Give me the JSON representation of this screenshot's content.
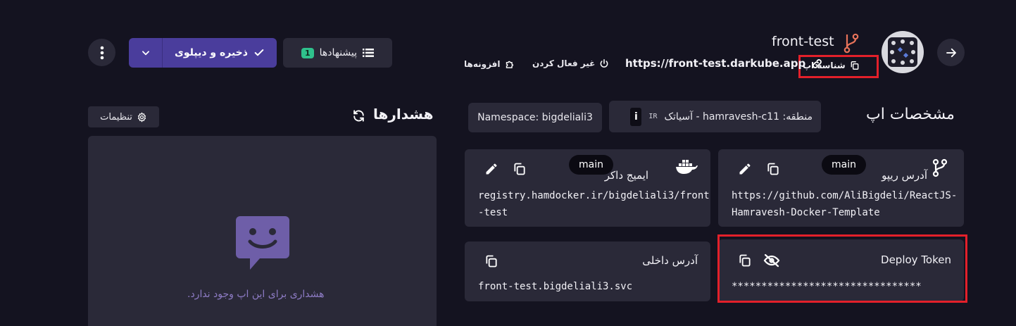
{
  "header": {
    "app_name": "front-test",
    "app_id_label": "شناسه اپ",
    "app_url": "https://front-test.darkube.app",
    "disable_label": "غیر فعال کردن",
    "addons_label": "افزونه‌ها",
    "save_deploy_label": "ذخیره و دیپلوی",
    "suggestions_label": "پیشنهادها",
    "suggestions_count": "1"
  },
  "specs": {
    "title": "مشخصات اپ",
    "region_label": "منطقه: hamravesh-c11 - آسیاتک",
    "region_flag": "IR",
    "namespace_label": "Namespace: bigdeliali3",
    "repo": {
      "title": "آدرس ریپو",
      "branch": "main",
      "value_line1": "https://github.com/AliBigdeli/ReactJS-",
      "value_line2": "Hamravesh-Docker-Template"
    },
    "image": {
      "title": "ایمیج داکر",
      "branch": "main",
      "value_line1": "registry.hamdocker.ir/bigdeliali3/front",
      "value_line2": "-test"
    },
    "token": {
      "title": "Deploy Token",
      "value": "********************************"
    },
    "internal": {
      "title": "آدرس داخلی",
      "value": "front-test.bigdeliali3.svc"
    }
  },
  "alerts": {
    "title": "هشدارها",
    "settings_label": "تنظیمات",
    "empty_text": "هشداری برای این اپ وجود ندارد."
  },
  "colors": {
    "background": "#141320",
    "card": "#2a2938",
    "primary": "#4a3d9c",
    "badge": "#2fc18c",
    "highlight": "#e3202a",
    "empty_icon": "#6e5ea8"
  }
}
